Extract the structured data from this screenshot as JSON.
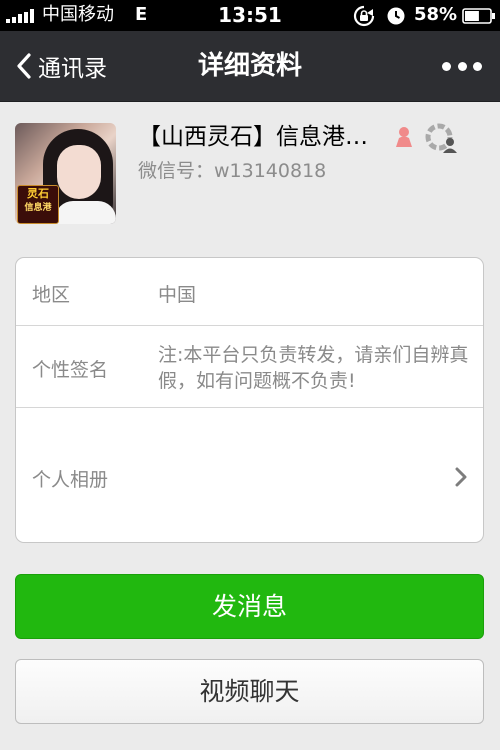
{
  "status_bar": {
    "carrier": "中国移动",
    "network": "E",
    "time": "13:51",
    "battery": "58%",
    "battery_level": 0.58,
    "icons": [
      "signal-bars-icon",
      "rotation-lock-icon",
      "alarm-icon",
      "battery-icon"
    ]
  },
  "nav": {
    "back_label": "通讯录",
    "title": "详细资料",
    "back_icon": "chevron-left-icon",
    "more_icon": "more-dots-icon"
  },
  "profile": {
    "name": "【山西灵石】信息港…",
    "wechat_id": "微信号：w13140818",
    "avatar_logo_line1": "灵石",
    "avatar_logo_line2": "信息港",
    "gender_icon": "female-icon",
    "moments_icon": "moments-icon"
  },
  "info": {
    "region_label": "地区",
    "region_value": "中国",
    "signature_label": "个性签名",
    "signature_value": "注:本平台只负责转发，请亲们自辨真假，如有问题概不负责!",
    "album_label": "个人相册"
  },
  "actions": {
    "send_message": "发消息",
    "video_chat": "视频聊天"
  },
  "colors": {
    "nav_bg": "#2d2e32",
    "page_bg": "#ebebeb",
    "send_button": "#21b80f"
  }
}
